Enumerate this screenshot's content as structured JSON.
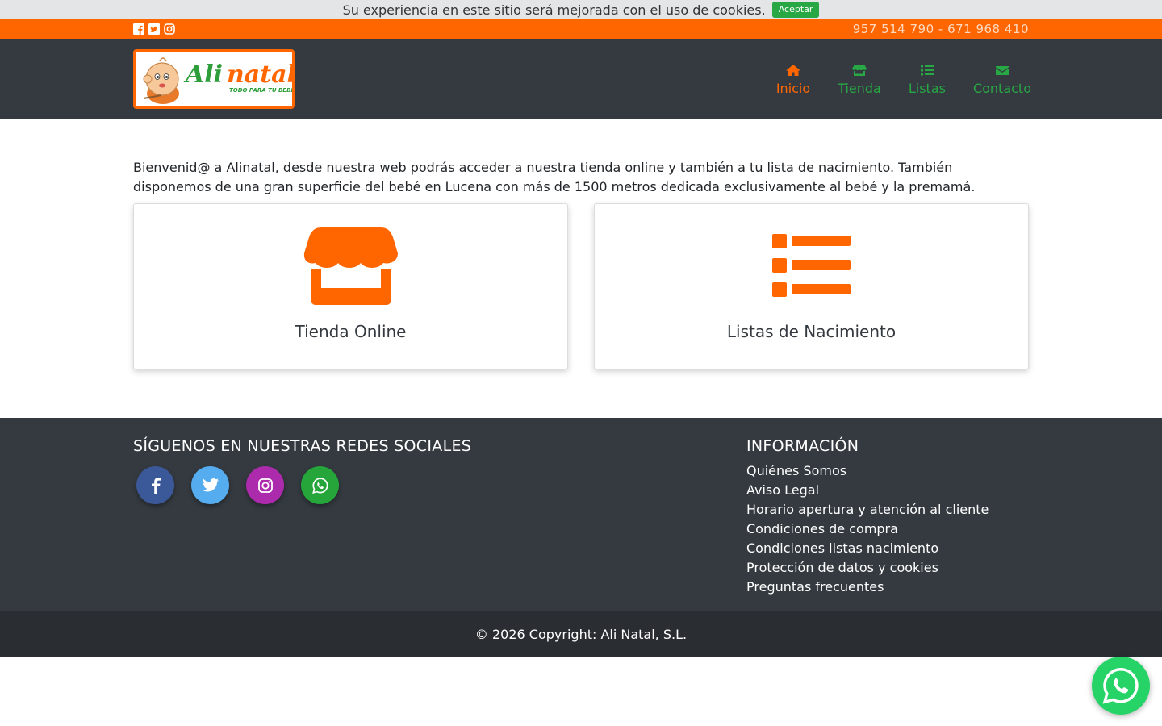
{
  "cookie": {
    "text": "Su experiencia en este sitio será mejorada con el uso de cookies.",
    "accept_label": "Aceptar"
  },
  "topbar": {
    "phone": "957 514 790 - 671 968 410",
    "social_icons": [
      "facebook-square-icon",
      "twitter-square-icon",
      "instagram-icon"
    ]
  },
  "logo": {
    "brand_ali": "Ali",
    "brand_natal": "natal",
    "tagline": "TODO PARA TU BEBÉ"
  },
  "nav": {
    "items": [
      {
        "label": "Inicio",
        "icon": "home-icon",
        "active": true
      },
      {
        "label": "Tienda",
        "icon": "store-icon",
        "active": false
      },
      {
        "label": "Listas",
        "icon": "list-icon",
        "active": false
      },
      {
        "label": "Contacto",
        "icon": "envelope-icon",
        "active": false
      }
    ]
  },
  "main": {
    "intro": "Bienvenid@ a Alinatal, desde nuestra web podrás acceder a nuestra tienda online y también a tu lista de nacimiento. También disponemos de una gran superficie del bebé en Lucena con más de 1500 metros dedicada exclusivamente al bebé y la premamá.",
    "cards": [
      {
        "title": "Tienda Online",
        "icon": "store-icon"
      },
      {
        "title": "Listas de Nacimiento",
        "icon": "list-icon"
      }
    ]
  },
  "footer": {
    "social_title": "SÍGUENOS EN NUESTRAS REDES SOCIALES",
    "info_title": "INFORMACIÓN",
    "info_links": [
      "Quiénes Somos",
      "Aviso Legal",
      "Horario apertura y atención al cliente",
      "Condiciones de compra",
      "Condiciones listas nacimiento",
      "Protección de datos y cookies",
      "Preguntas frecuentes"
    ],
    "copyright": "© 2026 Copyright: Ali Natal, S.L."
  },
  "colors": {
    "orange": "#ff6600",
    "green": "#28a745",
    "dark": "#343a40",
    "facebook": "#3b5998",
    "twitter": "#55acee",
    "instagram": "#ac2bac",
    "whatsapp": "#25d366"
  }
}
